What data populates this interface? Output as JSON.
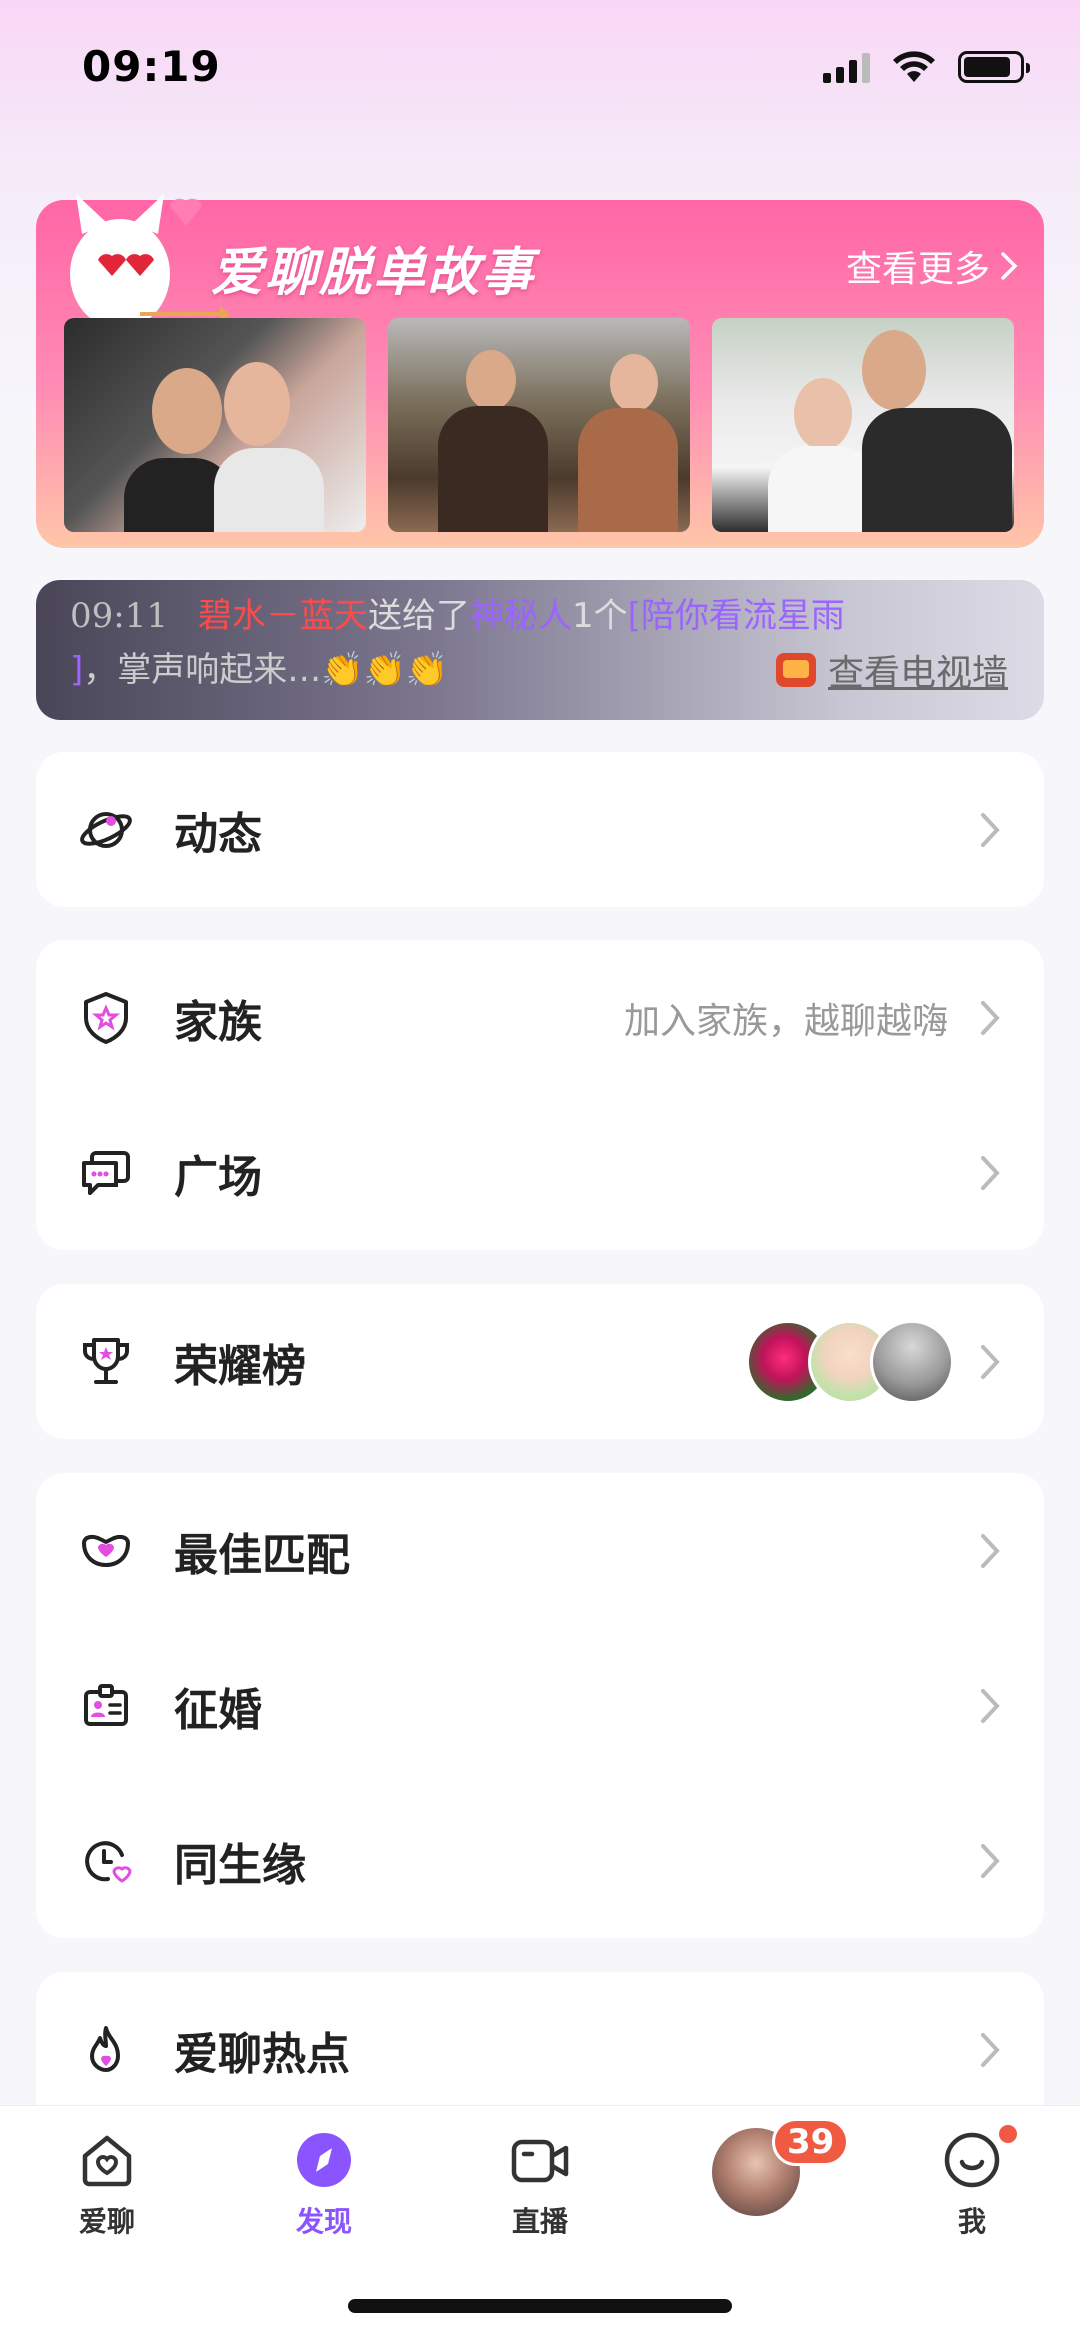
{
  "status_bar": {
    "time": "09:19"
  },
  "story_banner": {
    "title": "爱聊脱单故事",
    "more_label": "查看更多"
  },
  "ticker": {
    "time": "09:11",
    "sender": "碧水－蓝天",
    "action": "送给了",
    "receiver": "神秘人",
    "gift_count": "1个",
    "gift_name": "[陪你看流星雨",
    "gift_close": "]",
    "message": "，掌声响起来…👏👏👏",
    "tv_wall_label": "查看电视墙"
  },
  "menu": {
    "moments": {
      "label": "动态"
    },
    "family": {
      "label": "家族",
      "subtitle": "加入家族，越聊越嗨"
    },
    "square": {
      "label": "广场"
    },
    "honor": {
      "label": "荣耀榜"
    },
    "best_match": {
      "label": "最佳匹配"
    },
    "marriage": {
      "label": "征婚"
    },
    "same_birth": {
      "label": "同生缘"
    },
    "hot": {
      "label": "爱聊热点"
    }
  },
  "tabbar": {
    "chat": {
      "label": "爱聊"
    },
    "discover": {
      "label": "发现"
    },
    "live": {
      "label": "直播"
    },
    "messages_badge": "39",
    "me": {
      "label": "我"
    }
  },
  "colors": {
    "accent": "#8a55ff",
    "banner_pink": "#ff66a6",
    "badge_red": "#f05a43"
  }
}
